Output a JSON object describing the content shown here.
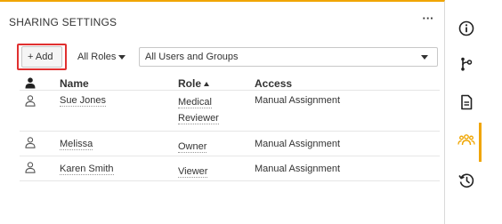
{
  "panel": {
    "title": "SHARING SETTINGS",
    "more_label": "···"
  },
  "toolbar": {
    "add_label": "+ Add",
    "roles_label": "All Roles",
    "users_select_value": "All Users and Groups"
  },
  "table": {
    "headers": {
      "name": "Name",
      "role": "Role",
      "access": "Access"
    },
    "sort": {
      "column": "role",
      "direction": "ascending"
    },
    "rows": [
      {
        "name": "Sue Jones",
        "role_line1": "Medical",
        "role_line2": "Reviewer",
        "access": "Manual Assignment"
      },
      {
        "name": "Melissa",
        "role_line1": "Owner",
        "role_line2": "",
        "access": "Manual Assignment"
      },
      {
        "name": "Karen Smith",
        "role_line1": "Viewer",
        "role_line2": "",
        "access": "Manual Assignment"
      }
    ]
  },
  "sidebar": {
    "icons": [
      "info-icon",
      "workflow-icon",
      "document-icon",
      "users-icon",
      "history-icon"
    ],
    "active": "users-icon"
  },
  "colors": {
    "accent": "#f0a500",
    "highlight": "#e03030",
    "text": "#333333"
  }
}
